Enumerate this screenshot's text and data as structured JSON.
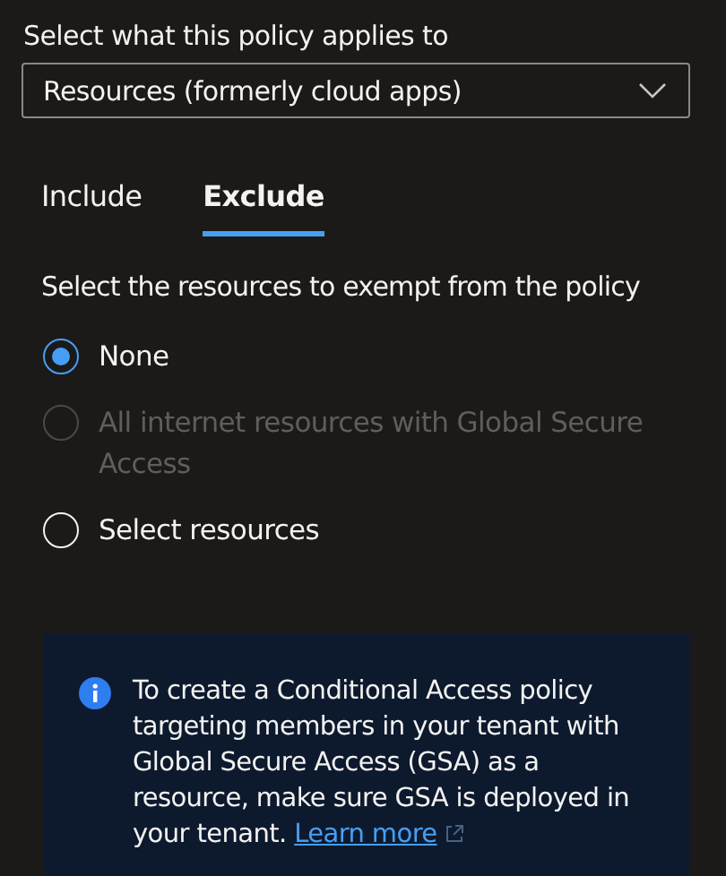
{
  "scope": {
    "label": "Select what this policy applies to",
    "value": "Resources (formerly cloud apps)"
  },
  "tabs": [
    {
      "label": "Include",
      "selected": false
    },
    {
      "label": "Exclude",
      "selected": true
    }
  ],
  "description": "Select the resources to exempt from the policy",
  "options": [
    {
      "label": "None",
      "selected": true,
      "disabled": false
    },
    {
      "label": "All internet resources with Global Secure Access",
      "selected": false,
      "disabled": true
    },
    {
      "label": "Select resources",
      "selected": false,
      "disabled": false
    }
  ],
  "info": {
    "text": "To create a Conditional Access policy targeting members in your tenant with Global Secure Access (GSA) as a resource, make sure GSA is deployed in your tenant.",
    "link": "Learn more"
  }
}
